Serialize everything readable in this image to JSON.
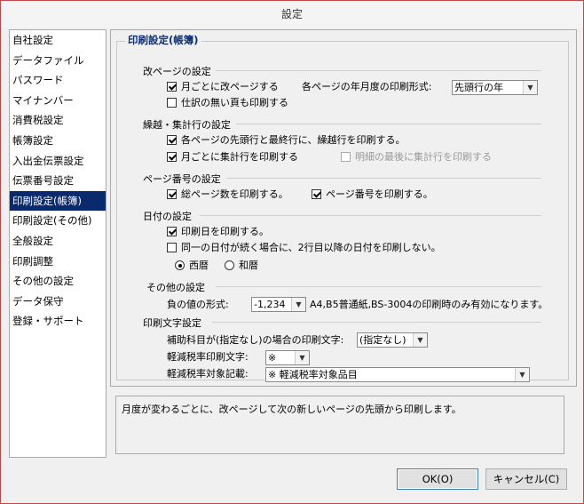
{
  "window": {
    "title": "設定"
  },
  "sidebar": {
    "items": [
      {
        "label": "自社設定"
      },
      {
        "label": "データファイル"
      },
      {
        "label": "パスワード"
      },
      {
        "label": "マイナンバー"
      },
      {
        "label": "消費税設定"
      },
      {
        "label": "帳簿設定"
      },
      {
        "label": "入出金伝票設定"
      },
      {
        "label": "伝票番号設定"
      },
      {
        "label": "印刷設定(帳簿)",
        "selected": true
      },
      {
        "label": "印刷設定(その他)"
      },
      {
        "label": "全般設定"
      },
      {
        "label": "印刷調整"
      },
      {
        "label": "その他の設定"
      },
      {
        "label": "データ保守"
      },
      {
        "label": "登録・サポート"
      }
    ]
  },
  "main": {
    "section_title": "印刷設定(帳簿)",
    "page_break": {
      "title": "改ページの設定",
      "monthly_break": {
        "label": "月ごとに改ページする",
        "checked": true
      },
      "year_month_format_label": "各ページの年月度の印刷形式:",
      "year_month_format_value": "先頭行の年",
      "print_empty_pages": {
        "label": "仕訳の無い頁も印刷する",
        "checked": false
      }
    },
    "carryover": {
      "title": "繰越・集計行の設定",
      "print_carryover": {
        "label": "各ページの先頭行と最終行に、繰越行を印刷する。",
        "checked": true
      },
      "print_monthly_total": {
        "label": "月ごとに集計行を印刷する",
        "checked": true
      },
      "print_total_after_detail": {
        "label": "明細の最後に集計行を印刷する",
        "checked": false,
        "disabled": true
      }
    },
    "page_number": {
      "title": "ページ番号の設定",
      "print_total_pages": {
        "label": "総ページ数を印刷する。",
        "checked": true
      },
      "print_page_number": {
        "label": "ページ番号を印刷する。",
        "checked": true
      }
    },
    "date": {
      "title": "日付の設定",
      "print_date": {
        "label": "印刷日を印刷する。",
        "checked": true
      },
      "suppress_repeat_date": {
        "label": "同一の日付が続く場合に、2行目以降の日付を印刷しない。",
        "checked": false
      },
      "era_western": {
        "label": "西暦",
        "checked": true
      },
      "era_japanese": {
        "label": "和暦",
        "checked": false
      }
    },
    "other": {
      "title": "その他の設定",
      "negative_format_label": "負の値の形式:",
      "negative_format_value": "-1,234",
      "negative_format_note": "A4,B5普通紙,BS-3004の印刷時のみ有効になります。"
    },
    "print_chars": {
      "title": "印刷文字設定",
      "sub_account_label": "補助科目が(指定なし)の場合の印刷文字:",
      "sub_account_value": "(指定なし)",
      "reduced_rate_char_label": "軽減税率印刷文字:",
      "reduced_rate_char_value": "※",
      "reduced_rate_note_label": "軽減税率対象記載:",
      "reduced_rate_note_value": "※ 軽減税率対象品目"
    }
  },
  "description": "月度が変わるごとに、改ページして次の新しいページの先頭から印刷します。",
  "buttons": {
    "ok": "OK(O)",
    "cancel": "キャンセル(C)"
  }
}
